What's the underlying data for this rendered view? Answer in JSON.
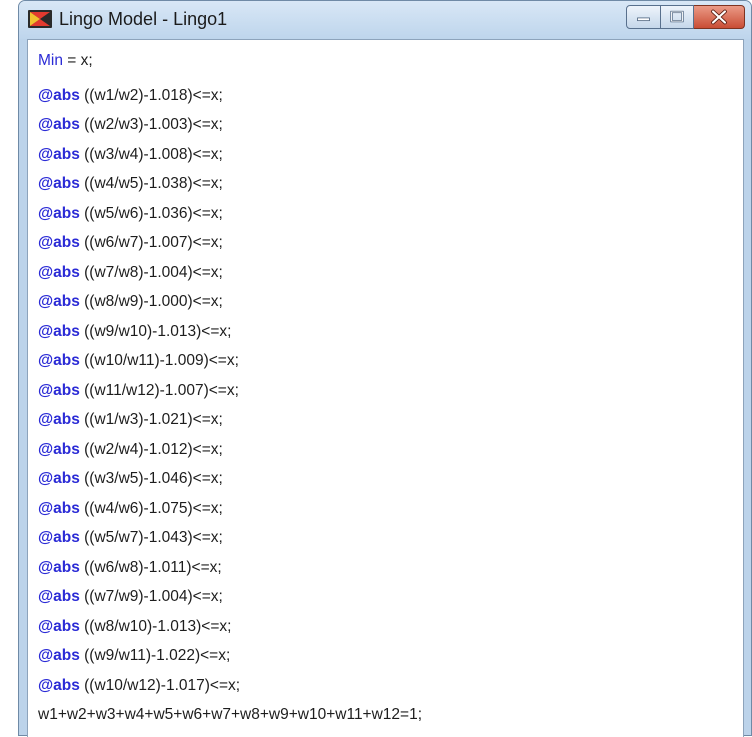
{
  "window": {
    "title": "Lingo Model - Lingo1",
    "controls": {
      "minimize_icon": "minimize-icon",
      "maximize_icon": "maximize-icon",
      "close_icon": "close-icon"
    },
    "colors": {
      "keyword": "#2b2bd6",
      "text": "#1d1d1d",
      "close_button": "#c94d35"
    }
  },
  "editor": {
    "objective": {
      "keyword": "Min",
      "rest": " = x;"
    },
    "constraints": [
      {
        "keyword": "@abs",
        "rest": " ((w1/w2)-1.018)<=x;"
      },
      {
        "keyword": "@abs",
        "rest": " ((w2/w3)-1.003)<=x;"
      },
      {
        "keyword": "@abs",
        "rest": " ((w3/w4)-1.008)<=x;"
      },
      {
        "keyword": "@abs",
        "rest": " ((w4/w5)-1.038)<=x;"
      },
      {
        "keyword": "@abs",
        "rest": " ((w5/w6)-1.036)<=x;"
      },
      {
        "keyword": "@abs",
        "rest": " ((w6/w7)-1.007)<=x;"
      },
      {
        "keyword": "@abs",
        "rest": " ((w7/w8)-1.004)<=x;"
      },
      {
        "keyword": "@abs",
        "rest": " ((w8/w9)-1.000)<=x;"
      },
      {
        "keyword": "@abs",
        "rest": " ((w9/w10)-1.013)<=x;"
      },
      {
        "keyword": "@abs",
        "rest": " ((w10/w11)-1.009)<=x;"
      },
      {
        "keyword": "@abs",
        "rest": " ((w11/w12)-1.007)<=x;"
      },
      {
        "keyword": "@abs",
        "rest": " ((w1/w3)-1.021)<=x;"
      },
      {
        "keyword": "@abs",
        "rest": " ((w2/w4)-1.012)<=x;"
      },
      {
        "keyword": "@abs",
        "rest": " ((w3/w5)-1.046)<=x;"
      },
      {
        "keyword": "@abs",
        "rest": " ((w4/w6)-1.075)<=x;"
      },
      {
        "keyword": "@abs",
        "rest": " ((w5/w7)-1.043)<=x;"
      },
      {
        "keyword": "@abs",
        "rest": " ((w6/w8)-1.011)<=x;"
      },
      {
        "keyword": "@abs",
        "rest": " ((w7/w9)-1.004)<=x;"
      },
      {
        "keyword": "@abs",
        "rest": " ((w8/w10)-1.013)<=x;"
      },
      {
        "keyword": "@abs",
        "rest": " ((w9/w11)-1.022)<=x;"
      },
      {
        "keyword": "@abs",
        "rest": " ((w10/w12)-1.017)<=x;"
      }
    ],
    "sum_line": "w1+w2+w3+w4+w5+w6+w7+w8+w9+w10+w11+w12=1;"
  }
}
